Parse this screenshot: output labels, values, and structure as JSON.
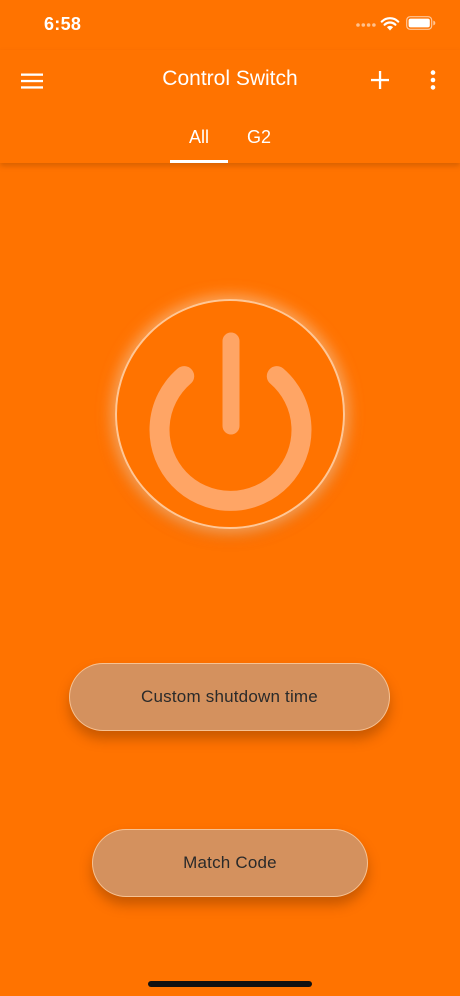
{
  "status_bar": {
    "time": "6:58",
    "signal_icon": "signal-dots-icon",
    "wifi_icon": "wifi-icon",
    "battery_icon": "battery-icon"
  },
  "app_bar": {
    "title": "Control Switch",
    "menu_icon": "hamburger-menu-icon",
    "add_icon": "plus-icon",
    "more_icon": "more-vertical-icon"
  },
  "tabs": [
    {
      "label": "All",
      "selected": true
    },
    {
      "label": "G2",
      "selected": false
    }
  ],
  "main": {
    "power_icon": "power-icon",
    "custom_shutdown_label": "Custom shutdown time",
    "match_code_label": "Match Code"
  },
  "colors": {
    "background": "#FF7300",
    "button_fill": "#D4915E",
    "power_glyph": "#FFA565",
    "text_on_button": "#2A2A2A"
  }
}
